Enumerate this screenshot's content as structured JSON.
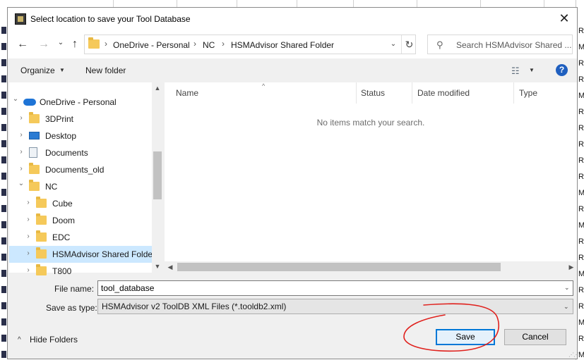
{
  "background": {
    "right_letters": [
      "R",
      "M",
      "R",
      "R",
      "M",
      "R",
      "R",
      "R",
      "R",
      "R",
      "M",
      "R",
      "M",
      "R",
      "R",
      "M",
      "R",
      "R",
      "M",
      "R",
      "M"
    ]
  },
  "dialog": {
    "title": "Select location to save your Tool Database",
    "close_glyph": "✕"
  },
  "nav": {
    "back": "←",
    "forward": "→",
    "recent": "⌄",
    "up": "↑",
    "breadcrumb": [
      "OneDrive - Personal",
      "NC",
      "HSMAdvisor Shared Folder"
    ],
    "sep": "›",
    "refresh": "↻",
    "search_placeholder": "Search HSMAdvisor Shared ..."
  },
  "toolbar": {
    "organize": "Organize",
    "new_folder": "New folder",
    "view_glyph": "☷",
    "help": "?"
  },
  "tree": [
    {
      "label": "OneDrive - Personal",
      "icon": "cloud",
      "expanded": true,
      "level": 0
    },
    {
      "label": "3DPrint",
      "icon": "folder",
      "level": 1
    },
    {
      "label": "Desktop",
      "icon": "desktop",
      "level": 1
    },
    {
      "label": "Documents",
      "icon": "docs",
      "level": 1
    },
    {
      "label": "Documents_old",
      "icon": "folder",
      "level": 1
    },
    {
      "label": "NC",
      "icon": "folder",
      "expanded": true,
      "level": 1
    },
    {
      "label": "Cube",
      "icon": "folder",
      "level": 2
    },
    {
      "label": "Doom",
      "icon": "folder",
      "level": 2
    },
    {
      "label": "EDC",
      "icon": "folder",
      "level": 2
    },
    {
      "label": "HSMAdvisor Shared Folde",
      "icon": "folder",
      "level": 2,
      "selected": true
    },
    {
      "label": "T800",
      "icon": "folder",
      "level": 2
    }
  ],
  "columns": [
    "Name",
    "Status",
    "Date modified",
    "Type"
  ],
  "empty_message": "No items match your search.",
  "form": {
    "file_name_label": "File name:",
    "file_name_value": "tool_database",
    "save_type_label": "Save as type:",
    "save_type_value": "HSMAdvisor v2 ToolDB XML Files (*.tooldb2.xml)"
  },
  "footer": {
    "hide_folders": "Hide Folders",
    "save": "Save",
    "cancel": "Cancel"
  },
  "colors": {
    "accent": "#0078d7",
    "selection": "#cce8ff",
    "annotation": "#e0201c"
  }
}
